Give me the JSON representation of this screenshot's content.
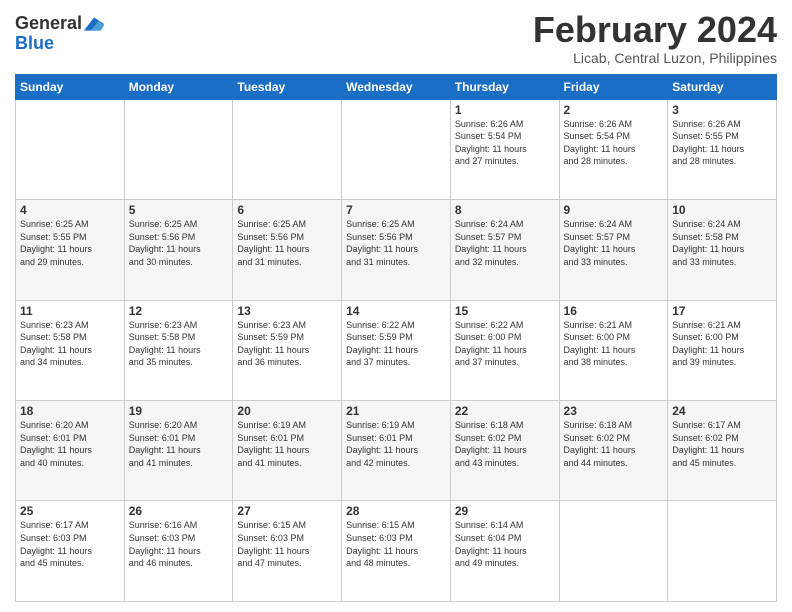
{
  "logo": {
    "line1": "General",
    "line2": "Blue"
  },
  "title": "February 2024",
  "location": "Licab, Central Luzon, Philippines",
  "days_header": [
    "Sunday",
    "Monday",
    "Tuesday",
    "Wednesday",
    "Thursday",
    "Friday",
    "Saturday"
  ],
  "weeks": [
    [
      {
        "day": "",
        "info": ""
      },
      {
        "day": "",
        "info": ""
      },
      {
        "day": "",
        "info": ""
      },
      {
        "day": "",
        "info": ""
      },
      {
        "day": "1",
        "info": "Sunrise: 6:26 AM\nSunset: 5:54 PM\nDaylight: 11 hours\nand 27 minutes."
      },
      {
        "day": "2",
        "info": "Sunrise: 6:26 AM\nSunset: 5:54 PM\nDaylight: 11 hours\nand 28 minutes."
      },
      {
        "day": "3",
        "info": "Sunrise: 6:26 AM\nSunset: 5:55 PM\nDaylight: 11 hours\nand 28 minutes."
      }
    ],
    [
      {
        "day": "4",
        "info": "Sunrise: 6:25 AM\nSunset: 5:55 PM\nDaylight: 11 hours\nand 29 minutes."
      },
      {
        "day": "5",
        "info": "Sunrise: 6:25 AM\nSunset: 5:56 PM\nDaylight: 11 hours\nand 30 minutes."
      },
      {
        "day": "6",
        "info": "Sunrise: 6:25 AM\nSunset: 5:56 PM\nDaylight: 11 hours\nand 31 minutes."
      },
      {
        "day": "7",
        "info": "Sunrise: 6:25 AM\nSunset: 5:56 PM\nDaylight: 11 hours\nand 31 minutes."
      },
      {
        "day": "8",
        "info": "Sunrise: 6:24 AM\nSunset: 5:57 PM\nDaylight: 11 hours\nand 32 minutes."
      },
      {
        "day": "9",
        "info": "Sunrise: 6:24 AM\nSunset: 5:57 PM\nDaylight: 11 hours\nand 33 minutes."
      },
      {
        "day": "10",
        "info": "Sunrise: 6:24 AM\nSunset: 5:58 PM\nDaylight: 11 hours\nand 33 minutes."
      }
    ],
    [
      {
        "day": "11",
        "info": "Sunrise: 6:23 AM\nSunset: 5:58 PM\nDaylight: 11 hours\nand 34 minutes."
      },
      {
        "day": "12",
        "info": "Sunrise: 6:23 AM\nSunset: 5:58 PM\nDaylight: 11 hours\nand 35 minutes."
      },
      {
        "day": "13",
        "info": "Sunrise: 6:23 AM\nSunset: 5:59 PM\nDaylight: 11 hours\nand 36 minutes."
      },
      {
        "day": "14",
        "info": "Sunrise: 6:22 AM\nSunset: 5:59 PM\nDaylight: 11 hours\nand 37 minutes."
      },
      {
        "day": "15",
        "info": "Sunrise: 6:22 AM\nSunset: 6:00 PM\nDaylight: 11 hours\nand 37 minutes."
      },
      {
        "day": "16",
        "info": "Sunrise: 6:21 AM\nSunset: 6:00 PM\nDaylight: 11 hours\nand 38 minutes."
      },
      {
        "day": "17",
        "info": "Sunrise: 6:21 AM\nSunset: 6:00 PM\nDaylight: 11 hours\nand 39 minutes."
      }
    ],
    [
      {
        "day": "18",
        "info": "Sunrise: 6:20 AM\nSunset: 6:01 PM\nDaylight: 11 hours\nand 40 minutes."
      },
      {
        "day": "19",
        "info": "Sunrise: 6:20 AM\nSunset: 6:01 PM\nDaylight: 11 hours\nand 41 minutes."
      },
      {
        "day": "20",
        "info": "Sunrise: 6:19 AM\nSunset: 6:01 PM\nDaylight: 11 hours\nand 41 minutes."
      },
      {
        "day": "21",
        "info": "Sunrise: 6:19 AM\nSunset: 6:01 PM\nDaylight: 11 hours\nand 42 minutes."
      },
      {
        "day": "22",
        "info": "Sunrise: 6:18 AM\nSunset: 6:02 PM\nDaylight: 11 hours\nand 43 minutes."
      },
      {
        "day": "23",
        "info": "Sunrise: 6:18 AM\nSunset: 6:02 PM\nDaylight: 11 hours\nand 44 minutes."
      },
      {
        "day": "24",
        "info": "Sunrise: 6:17 AM\nSunset: 6:02 PM\nDaylight: 11 hours\nand 45 minutes."
      }
    ],
    [
      {
        "day": "25",
        "info": "Sunrise: 6:17 AM\nSunset: 6:03 PM\nDaylight: 11 hours\nand 45 minutes."
      },
      {
        "day": "26",
        "info": "Sunrise: 6:16 AM\nSunset: 6:03 PM\nDaylight: 11 hours\nand 46 minutes."
      },
      {
        "day": "27",
        "info": "Sunrise: 6:15 AM\nSunset: 6:03 PM\nDaylight: 11 hours\nand 47 minutes."
      },
      {
        "day": "28",
        "info": "Sunrise: 6:15 AM\nSunset: 6:03 PM\nDaylight: 11 hours\nand 48 minutes."
      },
      {
        "day": "29",
        "info": "Sunrise: 6:14 AM\nSunset: 6:04 PM\nDaylight: 11 hours\nand 49 minutes."
      },
      {
        "day": "",
        "info": ""
      },
      {
        "day": "",
        "info": ""
      }
    ]
  ]
}
